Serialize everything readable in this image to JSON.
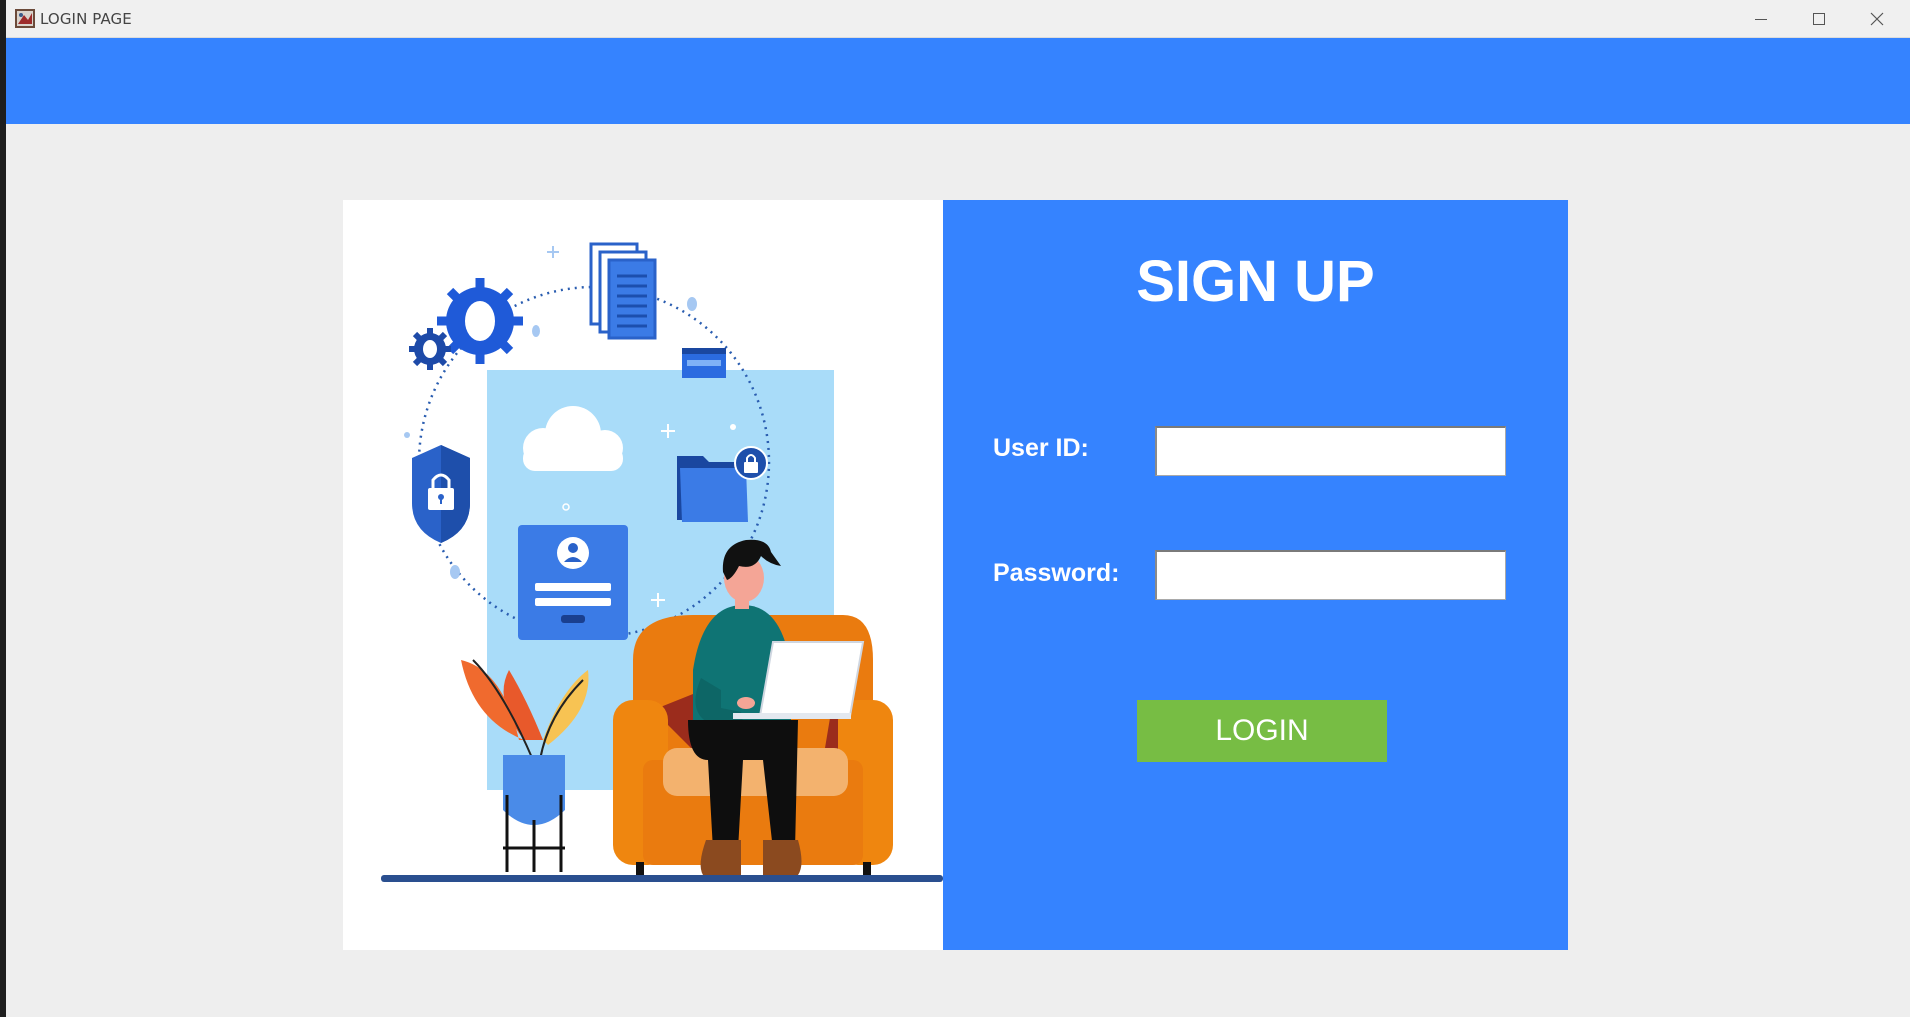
{
  "window": {
    "title": "LOGIN PAGE",
    "controls": [
      "minimize",
      "maximize",
      "close"
    ]
  },
  "banner": {
    "color": "#3583ff"
  },
  "form": {
    "title": "SIGN UP",
    "user_id_label": "User ID:",
    "user_id_value": "",
    "password_label": "Password:",
    "password_value": "",
    "login_label": "LOGIN"
  },
  "colors": {
    "accent": "#3583ff",
    "login_button": "#77bd44",
    "background": "#eeeeee"
  },
  "illustration": {
    "icons": [
      "gear-icon",
      "documents-icon",
      "browser-window-icon",
      "cloud-icon",
      "shield-lock-icon",
      "folder-lock-icon",
      "login-card-icon",
      "person-with-laptop",
      "armchair",
      "potted-plant"
    ]
  }
}
